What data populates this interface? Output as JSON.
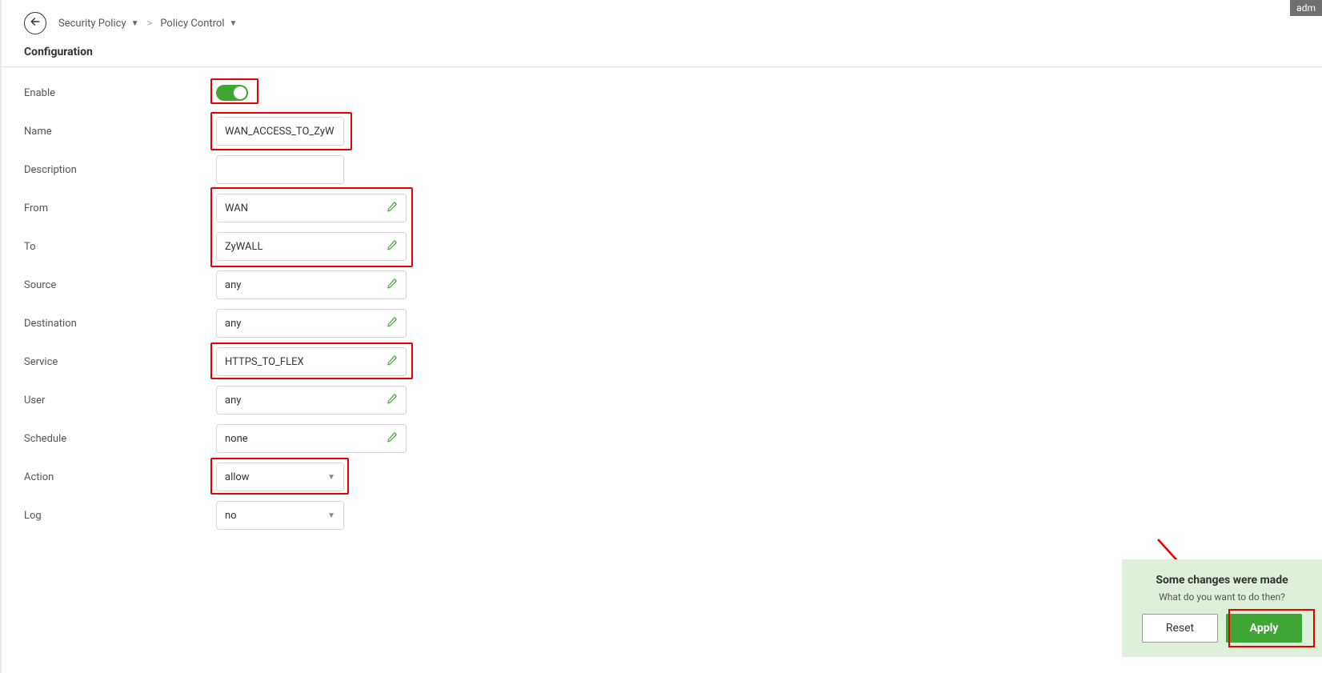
{
  "header": {
    "admin_tab": "adm"
  },
  "breadcrumb": {
    "item1": "Security Policy",
    "item2": "Policy Control"
  },
  "section_title": "Configuration",
  "fields": {
    "enable_label": "Enable",
    "name_label": "Name",
    "name_value": "WAN_ACCESS_TO_ZyW",
    "description_label": "Description",
    "description_value": "",
    "from_label": "From",
    "from_value": "WAN",
    "to_label": "To",
    "to_value": "ZyWALL",
    "source_label": "Source",
    "source_value": "any",
    "destination_label": "Destination",
    "destination_value": "any",
    "service_label": "Service",
    "service_value": "HTTPS_TO_FLEX",
    "user_label": "User",
    "user_value": "any",
    "schedule_label": "Schedule",
    "schedule_value": "none",
    "action_label": "Action",
    "action_value": "allow",
    "log_label": "Log",
    "log_value": "no"
  },
  "footer": {
    "title": "Some changes were made",
    "subtitle": "What do you want to do then?",
    "reset_label": "Reset",
    "apply_label": "Apply"
  }
}
